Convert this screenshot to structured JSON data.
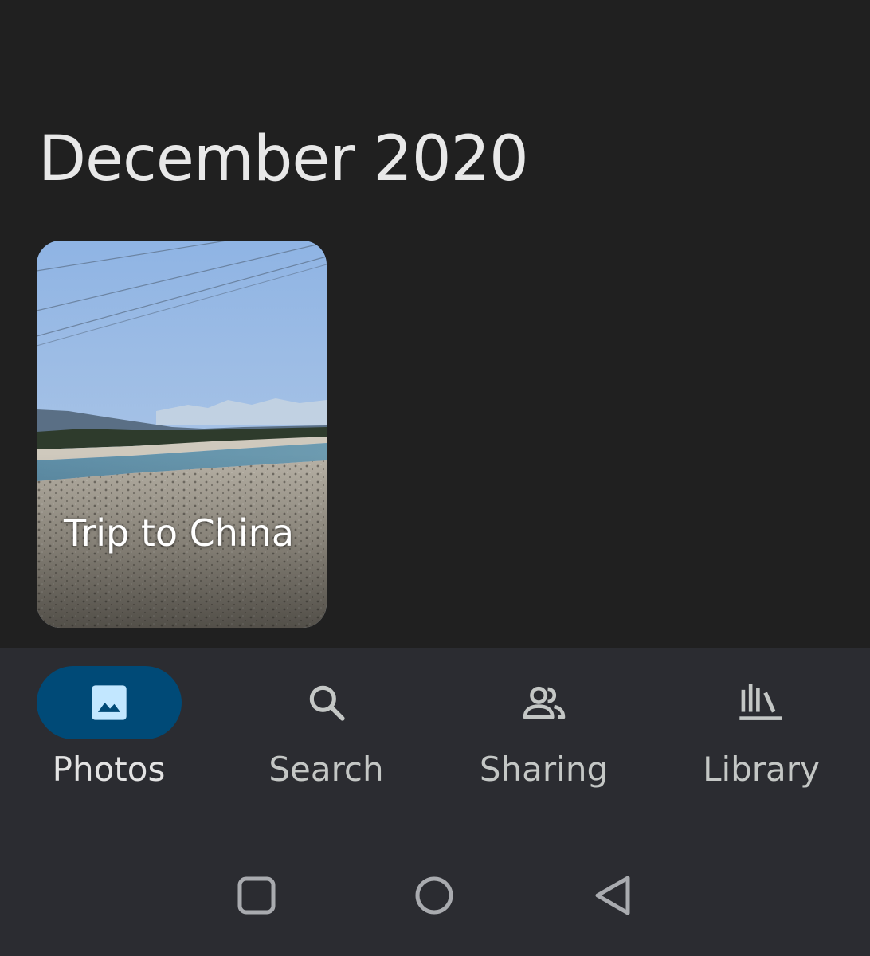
{
  "main": {
    "month_heading": "December 2020",
    "album": {
      "title": "Trip to China"
    }
  },
  "bottom_nav": {
    "items": [
      {
        "label": "Photos",
        "icon": "photo-icon",
        "active": true
      },
      {
        "label": "Search",
        "icon": "search-icon",
        "active": false
      },
      {
        "label": "Sharing",
        "icon": "people-icon",
        "active": false
      },
      {
        "label": "Library",
        "icon": "library-icon",
        "active": false
      }
    ]
  },
  "system_nav": {
    "buttons": [
      "recents-icon",
      "home-icon",
      "back-icon"
    ]
  },
  "colors": {
    "background": "#202020",
    "nav_background": "#2b2c31",
    "active_pill": "#004a77",
    "active_icon": "#c2e7ff",
    "inactive_icon": "#c4c7c5"
  }
}
